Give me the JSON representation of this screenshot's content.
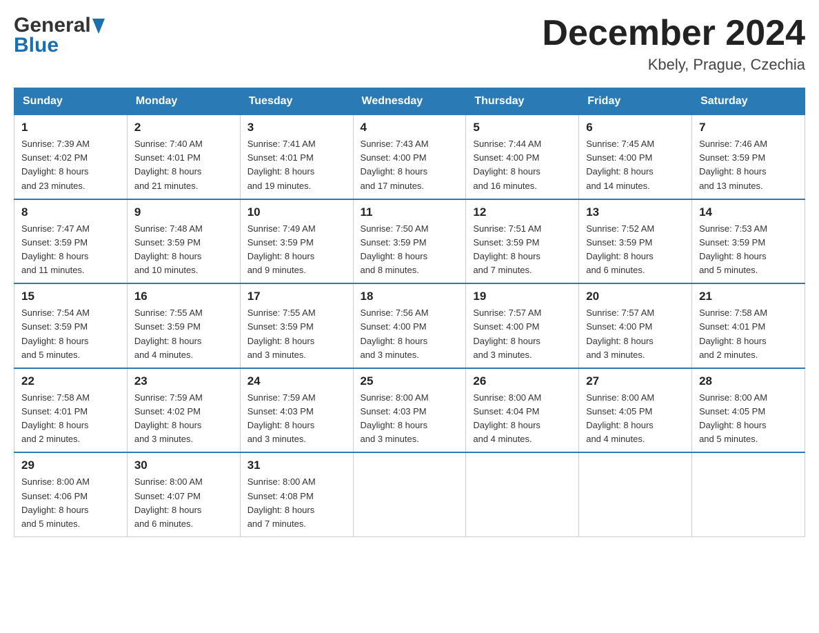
{
  "header": {
    "logo_general": "General",
    "logo_blue": "Blue",
    "month_title": "December 2024",
    "location": "Kbely, Prague, Czechia"
  },
  "days_of_week": [
    "Sunday",
    "Monday",
    "Tuesday",
    "Wednesday",
    "Thursday",
    "Friday",
    "Saturday"
  ],
  "weeks": [
    [
      {
        "day": "1",
        "sunrise": "Sunrise: 7:39 AM",
        "sunset": "Sunset: 4:02 PM",
        "daylight": "Daylight: 8 hours",
        "daylight2": "and 23 minutes."
      },
      {
        "day": "2",
        "sunrise": "Sunrise: 7:40 AM",
        "sunset": "Sunset: 4:01 PM",
        "daylight": "Daylight: 8 hours",
        "daylight2": "and 21 minutes."
      },
      {
        "day": "3",
        "sunrise": "Sunrise: 7:41 AM",
        "sunset": "Sunset: 4:01 PM",
        "daylight": "Daylight: 8 hours",
        "daylight2": "and 19 minutes."
      },
      {
        "day": "4",
        "sunrise": "Sunrise: 7:43 AM",
        "sunset": "Sunset: 4:00 PM",
        "daylight": "Daylight: 8 hours",
        "daylight2": "and 17 minutes."
      },
      {
        "day": "5",
        "sunrise": "Sunrise: 7:44 AM",
        "sunset": "Sunset: 4:00 PM",
        "daylight": "Daylight: 8 hours",
        "daylight2": "and 16 minutes."
      },
      {
        "day": "6",
        "sunrise": "Sunrise: 7:45 AM",
        "sunset": "Sunset: 4:00 PM",
        "daylight": "Daylight: 8 hours",
        "daylight2": "and 14 minutes."
      },
      {
        "day": "7",
        "sunrise": "Sunrise: 7:46 AM",
        "sunset": "Sunset: 3:59 PM",
        "daylight": "Daylight: 8 hours",
        "daylight2": "and 13 minutes."
      }
    ],
    [
      {
        "day": "8",
        "sunrise": "Sunrise: 7:47 AM",
        "sunset": "Sunset: 3:59 PM",
        "daylight": "Daylight: 8 hours",
        "daylight2": "and 11 minutes."
      },
      {
        "day": "9",
        "sunrise": "Sunrise: 7:48 AM",
        "sunset": "Sunset: 3:59 PM",
        "daylight": "Daylight: 8 hours",
        "daylight2": "and 10 minutes."
      },
      {
        "day": "10",
        "sunrise": "Sunrise: 7:49 AM",
        "sunset": "Sunset: 3:59 PM",
        "daylight": "Daylight: 8 hours",
        "daylight2": "and 9 minutes."
      },
      {
        "day": "11",
        "sunrise": "Sunrise: 7:50 AM",
        "sunset": "Sunset: 3:59 PM",
        "daylight": "Daylight: 8 hours",
        "daylight2": "and 8 minutes."
      },
      {
        "day": "12",
        "sunrise": "Sunrise: 7:51 AM",
        "sunset": "Sunset: 3:59 PM",
        "daylight": "Daylight: 8 hours",
        "daylight2": "and 7 minutes."
      },
      {
        "day": "13",
        "sunrise": "Sunrise: 7:52 AM",
        "sunset": "Sunset: 3:59 PM",
        "daylight": "Daylight: 8 hours",
        "daylight2": "and 6 minutes."
      },
      {
        "day": "14",
        "sunrise": "Sunrise: 7:53 AM",
        "sunset": "Sunset: 3:59 PM",
        "daylight": "Daylight: 8 hours",
        "daylight2": "and 5 minutes."
      }
    ],
    [
      {
        "day": "15",
        "sunrise": "Sunrise: 7:54 AM",
        "sunset": "Sunset: 3:59 PM",
        "daylight": "Daylight: 8 hours",
        "daylight2": "and 5 minutes."
      },
      {
        "day": "16",
        "sunrise": "Sunrise: 7:55 AM",
        "sunset": "Sunset: 3:59 PM",
        "daylight": "Daylight: 8 hours",
        "daylight2": "and 4 minutes."
      },
      {
        "day": "17",
        "sunrise": "Sunrise: 7:55 AM",
        "sunset": "Sunset: 3:59 PM",
        "daylight": "Daylight: 8 hours",
        "daylight2": "and 3 minutes."
      },
      {
        "day": "18",
        "sunrise": "Sunrise: 7:56 AM",
        "sunset": "Sunset: 4:00 PM",
        "daylight": "Daylight: 8 hours",
        "daylight2": "and 3 minutes."
      },
      {
        "day": "19",
        "sunrise": "Sunrise: 7:57 AM",
        "sunset": "Sunset: 4:00 PM",
        "daylight": "Daylight: 8 hours",
        "daylight2": "and 3 minutes."
      },
      {
        "day": "20",
        "sunrise": "Sunrise: 7:57 AM",
        "sunset": "Sunset: 4:00 PM",
        "daylight": "Daylight: 8 hours",
        "daylight2": "and 3 minutes."
      },
      {
        "day": "21",
        "sunrise": "Sunrise: 7:58 AM",
        "sunset": "Sunset: 4:01 PM",
        "daylight": "Daylight: 8 hours",
        "daylight2": "and 2 minutes."
      }
    ],
    [
      {
        "day": "22",
        "sunrise": "Sunrise: 7:58 AM",
        "sunset": "Sunset: 4:01 PM",
        "daylight": "Daylight: 8 hours",
        "daylight2": "and 2 minutes."
      },
      {
        "day": "23",
        "sunrise": "Sunrise: 7:59 AM",
        "sunset": "Sunset: 4:02 PM",
        "daylight": "Daylight: 8 hours",
        "daylight2": "and 3 minutes."
      },
      {
        "day": "24",
        "sunrise": "Sunrise: 7:59 AM",
        "sunset": "Sunset: 4:03 PM",
        "daylight": "Daylight: 8 hours",
        "daylight2": "and 3 minutes."
      },
      {
        "day": "25",
        "sunrise": "Sunrise: 8:00 AM",
        "sunset": "Sunset: 4:03 PM",
        "daylight": "Daylight: 8 hours",
        "daylight2": "and 3 minutes."
      },
      {
        "day": "26",
        "sunrise": "Sunrise: 8:00 AM",
        "sunset": "Sunset: 4:04 PM",
        "daylight": "Daylight: 8 hours",
        "daylight2": "and 4 minutes."
      },
      {
        "day": "27",
        "sunrise": "Sunrise: 8:00 AM",
        "sunset": "Sunset: 4:05 PM",
        "daylight": "Daylight: 8 hours",
        "daylight2": "and 4 minutes."
      },
      {
        "day": "28",
        "sunrise": "Sunrise: 8:00 AM",
        "sunset": "Sunset: 4:05 PM",
        "daylight": "Daylight: 8 hours",
        "daylight2": "and 5 minutes."
      }
    ],
    [
      {
        "day": "29",
        "sunrise": "Sunrise: 8:00 AM",
        "sunset": "Sunset: 4:06 PM",
        "daylight": "Daylight: 8 hours",
        "daylight2": "and 5 minutes."
      },
      {
        "day": "30",
        "sunrise": "Sunrise: 8:00 AM",
        "sunset": "Sunset: 4:07 PM",
        "daylight": "Daylight: 8 hours",
        "daylight2": "and 6 minutes."
      },
      {
        "day": "31",
        "sunrise": "Sunrise: 8:00 AM",
        "sunset": "Sunset: 4:08 PM",
        "daylight": "Daylight: 8 hours",
        "daylight2": "and 7 minutes."
      },
      null,
      null,
      null,
      null
    ]
  ]
}
